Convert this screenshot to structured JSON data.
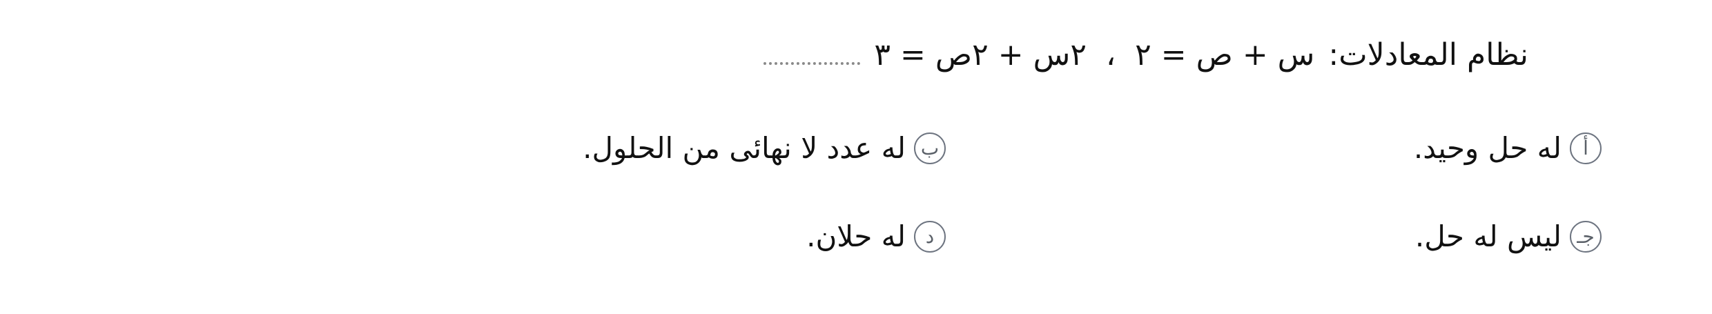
{
  "question": {
    "stem": "نظام المعادلات:",
    "equation_1": "س + ص = ٢",
    "separator": "،",
    "equation_2": "٢س + ٢ص = ٣",
    "dots": "..............."
  },
  "choices": [
    {
      "letter": "أ",
      "text": "له حل وحيد."
    },
    {
      "letter": "ب",
      "text": "له عدد لا نهائى من الحلول."
    },
    {
      "letter": "جـ",
      "text": "ليس له حل."
    },
    {
      "letter": "د",
      "text": "له حلان."
    }
  ],
  "colors": {
    "text": "#111111",
    "choice_border": "#6d7480",
    "dots": "#8a8a8a",
    "background": "#ffffff"
  }
}
